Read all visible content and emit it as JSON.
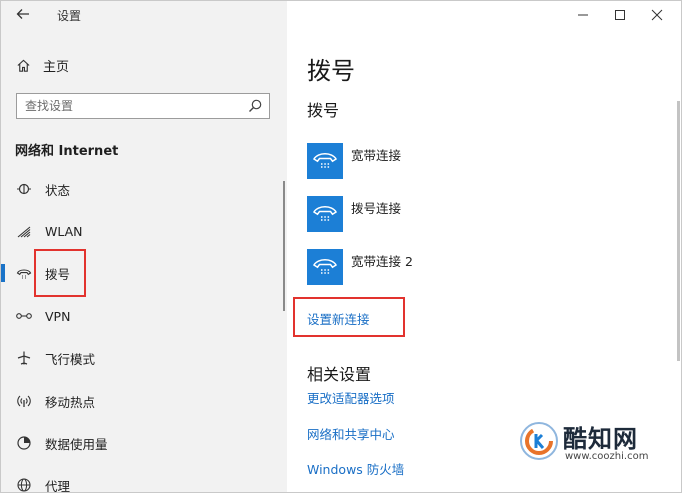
{
  "window": {
    "title": "设置"
  },
  "sidebar": {
    "home_label": "主页",
    "search_placeholder": "查找设置",
    "section_title": "网络和 Internet",
    "items": [
      {
        "label": "状态",
        "icon": "status-icon"
      },
      {
        "label": "WLAN",
        "icon": "wifi-icon"
      },
      {
        "label": "拨号",
        "icon": "dialup-icon",
        "active": true
      },
      {
        "label": "VPN",
        "icon": "vpn-icon"
      },
      {
        "label": "飞行模式",
        "icon": "airplane-icon"
      },
      {
        "label": "移动热点",
        "icon": "hotspot-icon"
      },
      {
        "label": "数据使用量",
        "icon": "data-usage-icon"
      },
      {
        "label": "代理",
        "icon": "globe-icon"
      }
    ]
  },
  "main": {
    "page_title": "拨号",
    "section_title": "拨号",
    "connections": [
      {
        "label": "宽带连接"
      },
      {
        "label": "拨号连接"
      },
      {
        "label": "宽带连接 2"
      }
    ],
    "setup_link": "设置新连接",
    "related_title": "相关设置",
    "related_links": [
      "更改适配器选项",
      "网络和共享中心",
      "Windows 防火墙"
    ]
  },
  "watermark": {
    "name": "酷知网",
    "url": "www.coozhi.com"
  },
  "colors": {
    "accent": "#1c7fd6",
    "link": "#1a6fc6",
    "highlight": "#e2332e",
    "sidebar_bg": "#f2f2f2"
  }
}
